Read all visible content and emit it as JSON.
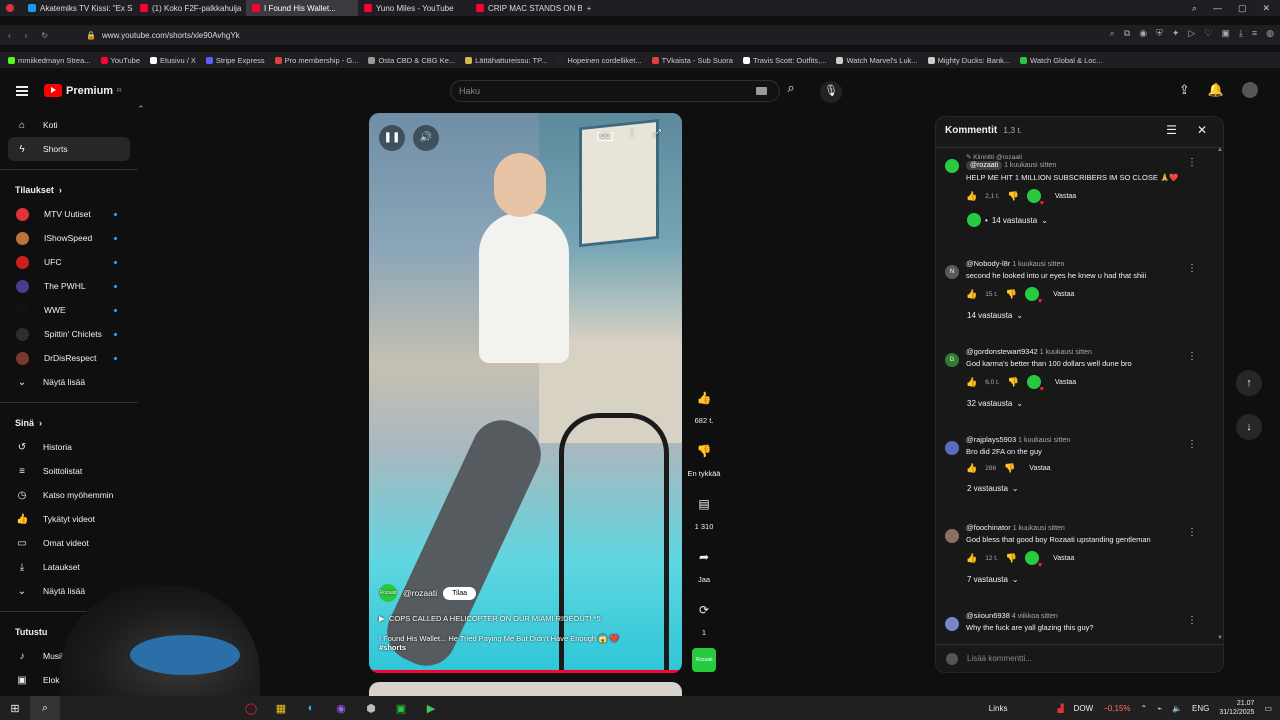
{
  "browser": {
    "tabs": [
      {
        "title": "Akatemiks TV Kissi: \"Ex S",
        "color": "#1d9bf0",
        "active": false
      },
      {
        "title": "(1) Koko F2F-palkkahuija",
        "color": "#ff0033",
        "active": false
      },
      {
        "title": "I Found His Wallet...",
        "color": "#ff0033",
        "active": true
      },
      {
        "title": "Yuno Miles - YouTube",
        "color": "#ff0033",
        "active": false
      },
      {
        "title": "CRIP MAC STANDS ON BL",
        "color": "#ff0033",
        "active": false
      }
    ],
    "new_tab": "+",
    "url": "www.youtube.com/shorts/xle90AvhgYk",
    "bookmarks": [
      {
        "label": "mmiikedmayn Strea...",
        "color": "#53fc18"
      },
      {
        "label": "YouTube",
        "color": "#ff0033"
      },
      {
        "label": "Etusivu / X",
        "color": "#ffffff"
      },
      {
        "label": "Stripe Express",
        "color": "#635bff"
      },
      {
        "label": "Pro membership - G...",
        "color": "#e04040"
      },
      {
        "label": "Osta CBD & CBG Ke...",
        "color": "#999999"
      },
      {
        "label": "Lättähattureissu: TP...",
        "color": "#d4b84a"
      },
      {
        "label": "Hopeinen cordelliket...",
        "color": "#222222"
      },
      {
        "label": "TVkaista - Sub Suora",
        "color": "#e04040"
      },
      {
        "label": "Travis Scott: Outfits,...",
        "color": "#ffffff"
      },
      {
        "label": "Watch Marvel's Luk...",
        "color": "#cccccc"
      },
      {
        "label": "Mighty Ducks: Bank...",
        "color": "#cccccc"
      },
      {
        "label": "Watch Global & Loc...",
        "color": "#27c93f"
      }
    ]
  },
  "youtube": {
    "logo_text": "Premium",
    "logo_sup": "FI",
    "search_placeholder": "Haku",
    "sidebar": {
      "main": [
        {
          "label": "Koti",
          "icon": "home-icon",
          "glyph": "⌂"
        },
        {
          "label": "Shorts",
          "icon": "shorts-icon",
          "glyph": "ϟ",
          "selected": true
        }
      ],
      "subs_header": "Tilaukset",
      "subscriptions": [
        {
          "label": "MTV Uutiset",
          "color": "#e0323c"
        },
        {
          "label": "IShowSpeed",
          "color": "#b8743a"
        },
        {
          "label": "UFC",
          "color": "#d01e1e"
        },
        {
          "label": "The PWHL",
          "color": "#4a3b8c"
        },
        {
          "label": "WWE",
          "color": "#111111"
        },
        {
          "label": "Spittin' Chiclets",
          "color": "#2d2d2d"
        },
        {
          "label": "DrDisRespect",
          "color": "#7a3a2a"
        }
      ],
      "show_more": "Näytä lisää",
      "you_header": "Sinä",
      "you_items": [
        {
          "label": "Historia",
          "icon": "history-icon",
          "glyph": "↺"
        },
        {
          "label": "Soittolistat",
          "icon": "playlists-icon",
          "glyph": "≡"
        },
        {
          "label": "Katso myöhemmin",
          "icon": "watch-later-icon",
          "glyph": "◷"
        },
        {
          "label": "Tykätyt videot",
          "icon": "liked-icon",
          "glyph": "👍"
        },
        {
          "label": "Omat videot",
          "icon": "your-videos-icon",
          "glyph": "▭"
        },
        {
          "label": "Lataukset",
          "icon": "downloads-icon",
          "glyph": "⤓"
        }
      ],
      "show_more_2": "Näytä lisää",
      "explore_header": "Tutustu",
      "explore_items": [
        {
          "label": "Musiikki",
          "icon": "music-icon",
          "glyph": "♪"
        },
        {
          "label": "Elokuv",
          "icon": "movies-icon",
          "glyph": "▣"
        }
      ]
    },
    "video": {
      "channel": "@rozaati",
      "subscribe_label": "Tilaa",
      "channel_avatar_text": "Rozaati",
      "title_line1": "COPS CALLED A HELICOPTER ON OUR MIAMI RIDEOUT! *5",
      "title_line2": "I Found His Wallet... He Tried Paying Me But Didn't Have Enough 😱 ❤️",
      "hashtag": "#shorts",
      "progress": 0.99
    },
    "actions": {
      "likes": "682 t.",
      "dislike_label": "En tykkää",
      "comments": "1 310",
      "share_label": "Jaa",
      "remix": "1"
    },
    "comments": {
      "header": "Kommentit",
      "count": "1,3 t.",
      "add_placeholder": "Lisää kommentti...",
      "items": [
        {
          "pinned": "Kiinnitti @rozaati",
          "author": "@rozaati",
          "owner": true,
          "time": "1 kuukausi sitten",
          "text": "HELP ME HIT 1 MILLION SUBSCRIBERS IM SO CLOSE 🙏❤️",
          "likes": "2,1 t.",
          "heart": true,
          "reply": "Vastaa",
          "replies": "14 vastausta",
          "avatar_color": "#27c93f",
          "avatar_letter": ""
        },
        {
          "author": "@Nobody-l8r",
          "time": "1 kuukausi sitten",
          "text": "second he looked into ur eyes he knew u had that shiii",
          "likes": "15 t.",
          "heart": true,
          "reply": "Vastaa",
          "replies": "14 vastausta",
          "avatar_color": "#5a5a5a",
          "avatar_letter": "N"
        },
        {
          "author": "@gordonstewart9342",
          "time": "1 kuukausi sitten",
          "text": "God karma's better than 100 dollars well dune bro",
          "likes": "6,0 t.",
          "heart": true,
          "reply": "Vastaa",
          "replies": "32 vastausta",
          "avatar_color": "#2e7d32",
          "avatar_letter": "G"
        },
        {
          "author": "@rajplays5903",
          "time": "1 kuukausi sitten",
          "text": "Bro did 2FA on the guy",
          "likes": "286",
          "heart": false,
          "reply": "Vastaa",
          "replies": "2 vastausta",
          "avatar_color": "#5c6bc0",
          "avatar_letter": ""
        },
        {
          "author": "@foochinator",
          "time": "1 kuukausi sitten",
          "text": "God bless that good boy Rozaati upstanding gentleman",
          "likes": "12 t.",
          "heart": true,
          "reply": "Vastaa",
          "replies": "7 vastausta",
          "avatar_color": "#8d6e63",
          "avatar_letter": ""
        },
        {
          "author": "@siioun6938",
          "time": "4 viikkoa sitten",
          "text": "Why the fuck are yall glazing this guy?",
          "likes": "",
          "heart": false,
          "reply": "",
          "replies": "",
          "avatar_color": "#7986cb",
          "avatar_letter": ""
        }
      ]
    }
  },
  "taskbar": {
    "links_label": "Links",
    "ticker": "DOW",
    "ticker_change": "−0,15%",
    "lang": "ENG",
    "time": "21.07",
    "date": "31/12/2025"
  }
}
